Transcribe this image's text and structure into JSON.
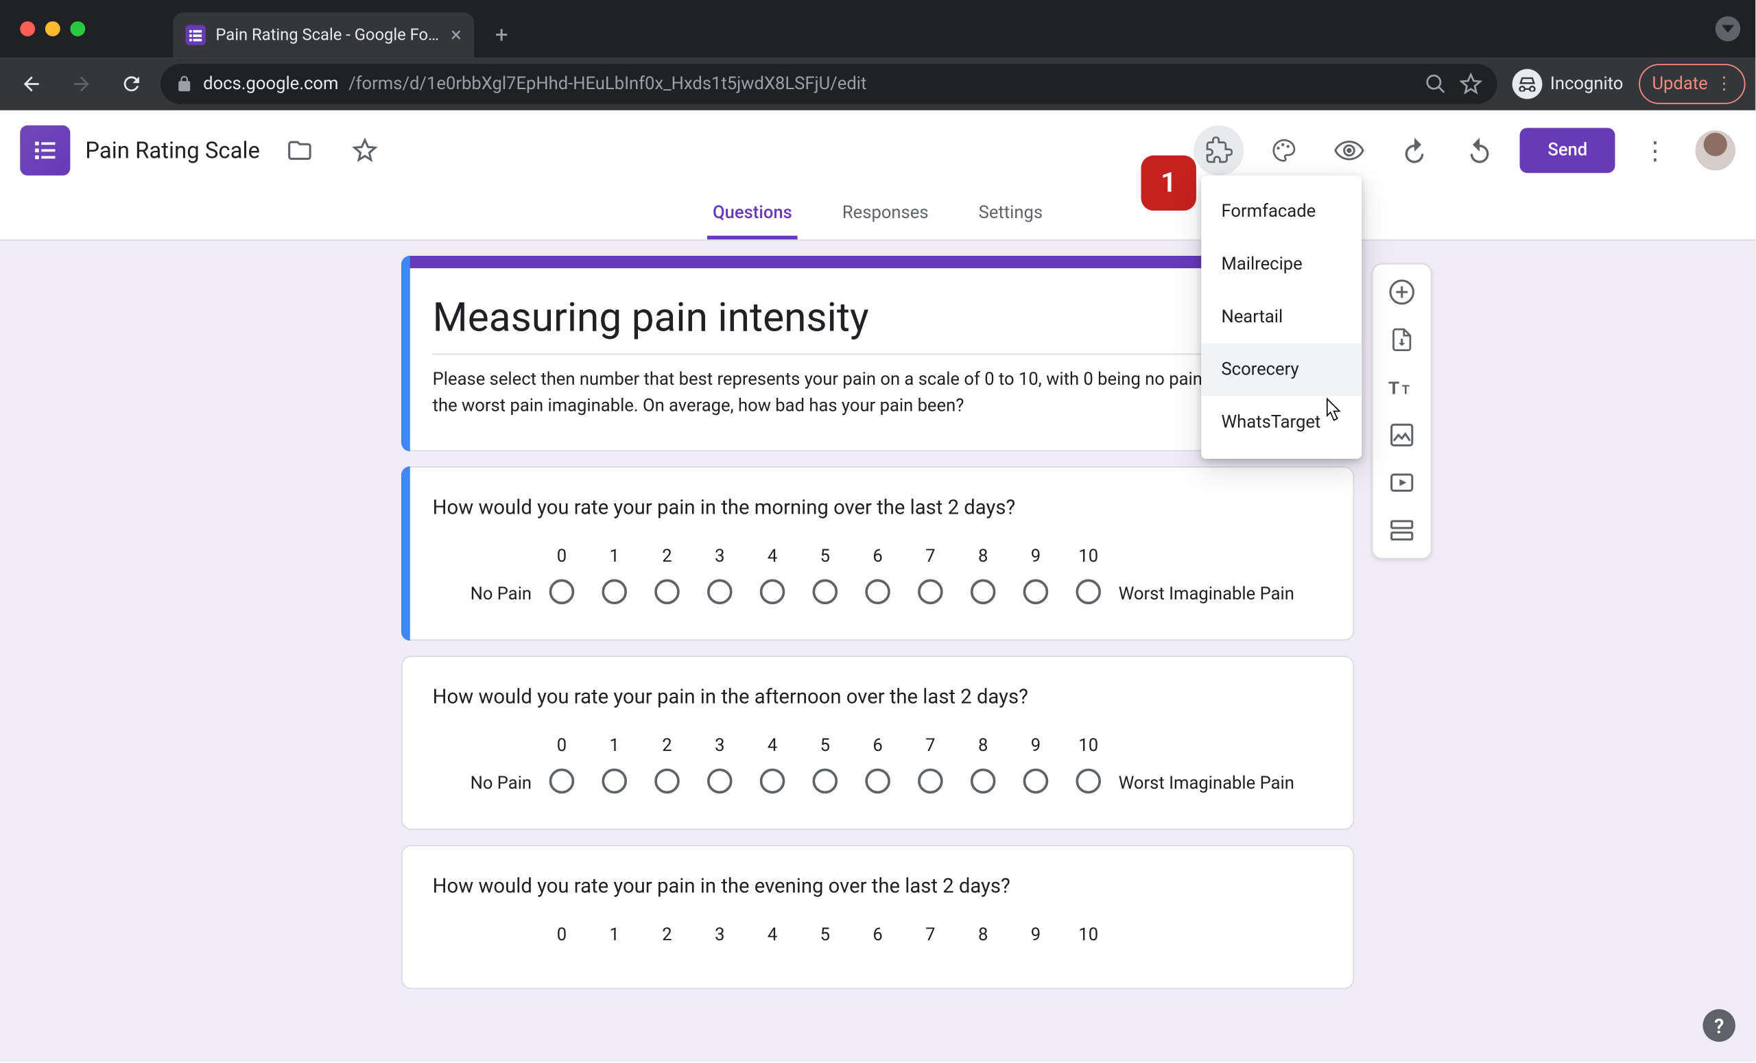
{
  "browser": {
    "tab_title": "Pain Rating Scale - Google Forms",
    "url_host": "docs.google.com",
    "url_path": "/forms/d/1e0rbbXgl7EpHhd-HEuLbInf0x_Hxds1t5jwdX8LSFjU/edit",
    "incognito_label": "Incognito",
    "update_label": "Update"
  },
  "header": {
    "doc_title": "Pain Rating Scale",
    "send_label": "Send",
    "badge": "1"
  },
  "tabs": {
    "questions": "Questions",
    "responses": "Responses",
    "settings": "Settings"
  },
  "addons": {
    "items": [
      "Formfacade",
      "Mailrecipe",
      "Neartail",
      "Scorecery",
      "WhatsTarget"
    ],
    "hover_index": 3
  },
  "form": {
    "title": "Measuring pain intensity",
    "description": "Please select then number that best represents your pain on a scale of 0 to 10, with 0 being no pain and 10 being the worst pain imaginable. On average, how bad has your pain been?",
    "scale_numbers": [
      "0",
      "1",
      "2",
      "3",
      "4",
      "5",
      "6",
      "7",
      "8",
      "9",
      "10"
    ],
    "low_label": "No Pain",
    "high_label": "Worst Imaginable Pain",
    "questions": [
      {
        "title": "How would you rate your pain in the morning over the last 2 days?",
        "selected": true
      },
      {
        "title": "How would you rate your pain in the afternoon over the last 2 days?",
        "selected": false
      },
      {
        "title": "How would you rate your pain in the evening over the last 2 days?",
        "selected": false
      }
    ]
  }
}
